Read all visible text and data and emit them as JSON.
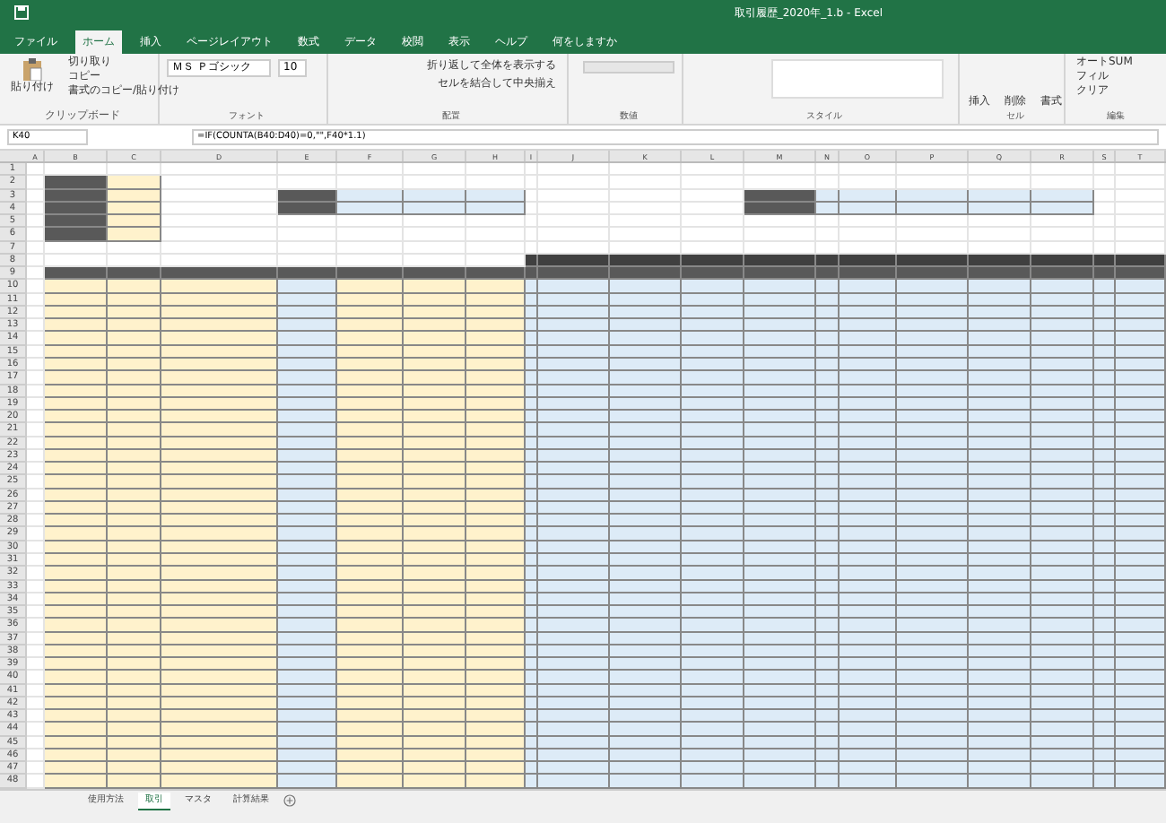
{
  "window": {
    "title": "取引履歴_2020年_1.b - Excel"
  },
  "ribbon_tabs": [
    {
      "label": "ファイル",
      "selected": false
    },
    {
      "label": "ホーム",
      "selected": true
    },
    {
      "label": "挿入",
      "selected": false
    },
    {
      "label": "ページレイアウト",
      "selected": false
    },
    {
      "label": "数式",
      "selected": false
    },
    {
      "label": "データ",
      "selected": false
    },
    {
      "label": "校閲",
      "selected": false
    },
    {
      "label": "表示",
      "selected": false
    },
    {
      "label": "ヘルプ",
      "selected": false
    },
    {
      "label": "何をしますか",
      "selected": false
    }
  ],
  "clipboard": {
    "paste": "貼り付け",
    "cut": "切り取り",
    "copy": "コピー",
    "format_painter": "書式のコピー/貼り付け"
  },
  "font": {
    "name": "ＭＳ Ｐゴシック",
    "size": "10"
  },
  "alignment": {
    "wrap": "折り返して全体を表示する",
    "merge": "セルを結合して中央揃え"
  },
  "cells_group": {
    "insert": "挿入",
    "delete": "削除",
    "format": "書式"
  },
  "editing": {
    "autosum": "オートSUM",
    "fill": "フィル",
    "clear": "クリア"
  },
  "groups": [
    "クリップボード",
    "フォント",
    "配置",
    "数値",
    "スタイル",
    "セル",
    "編集"
  ],
  "name_box": "K40",
  "formula": "=IF(COUNTA(B40:D40)=0,\"\",F40*1.1)",
  "columns": [
    {
      "letter": "A",
      "kind": "plain"
    },
    {
      "letter": "B",
      "kind": "yellow"
    },
    {
      "letter": "C",
      "kind": "yellow"
    },
    {
      "letter": "D",
      "kind": "yellow"
    },
    {
      "letter": "E",
      "kind": "blue"
    },
    {
      "letter": "F",
      "kind": "yellow"
    },
    {
      "letter": "G",
      "kind": "yellow"
    },
    {
      "letter": "H",
      "kind": "yellow"
    },
    {
      "letter": "I",
      "kind": "blue"
    },
    {
      "letter": "J",
      "kind": "blue"
    },
    {
      "letter": "K",
      "kind": "blue"
    },
    {
      "letter": "L",
      "kind": "blue"
    },
    {
      "letter": "M",
      "kind": "blue"
    },
    {
      "letter": "N",
      "kind": "blue"
    },
    {
      "letter": "O",
      "kind": "blue"
    },
    {
      "letter": "P",
      "kind": "blue"
    },
    {
      "letter": "Q",
      "kind": "blue"
    },
    {
      "letter": "R",
      "kind": "blue"
    },
    {
      "letter": "S",
      "kind": "blue"
    },
    {
      "letter": "T",
      "kind": "blue"
    }
  ],
  "row_count_label": [
    "1",
    "2",
    "3",
    "4",
    "5",
    "6",
    "7",
    "8",
    "9",
    "10",
    "11",
    "12",
    "13",
    "14",
    "15",
    "16",
    "17",
    "18",
    "19",
    "20",
    "21",
    "22",
    "23",
    "24",
    "25",
    "26",
    "27",
    "28",
    "29",
    "30",
    "31",
    "32",
    "33",
    "34",
    "35",
    "36",
    "37",
    "38",
    "39",
    "40",
    "41",
    "42",
    "43",
    "44",
    "45",
    "46",
    "47",
    "48"
  ],
  "sheet_tabs": [
    {
      "label": "使用方法",
      "selected": false
    },
    {
      "label": "取引",
      "selected": true
    },
    {
      "label": "マスタ",
      "selected": false
    },
    {
      "label": "計算結果",
      "selected": false
    }
  ]
}
